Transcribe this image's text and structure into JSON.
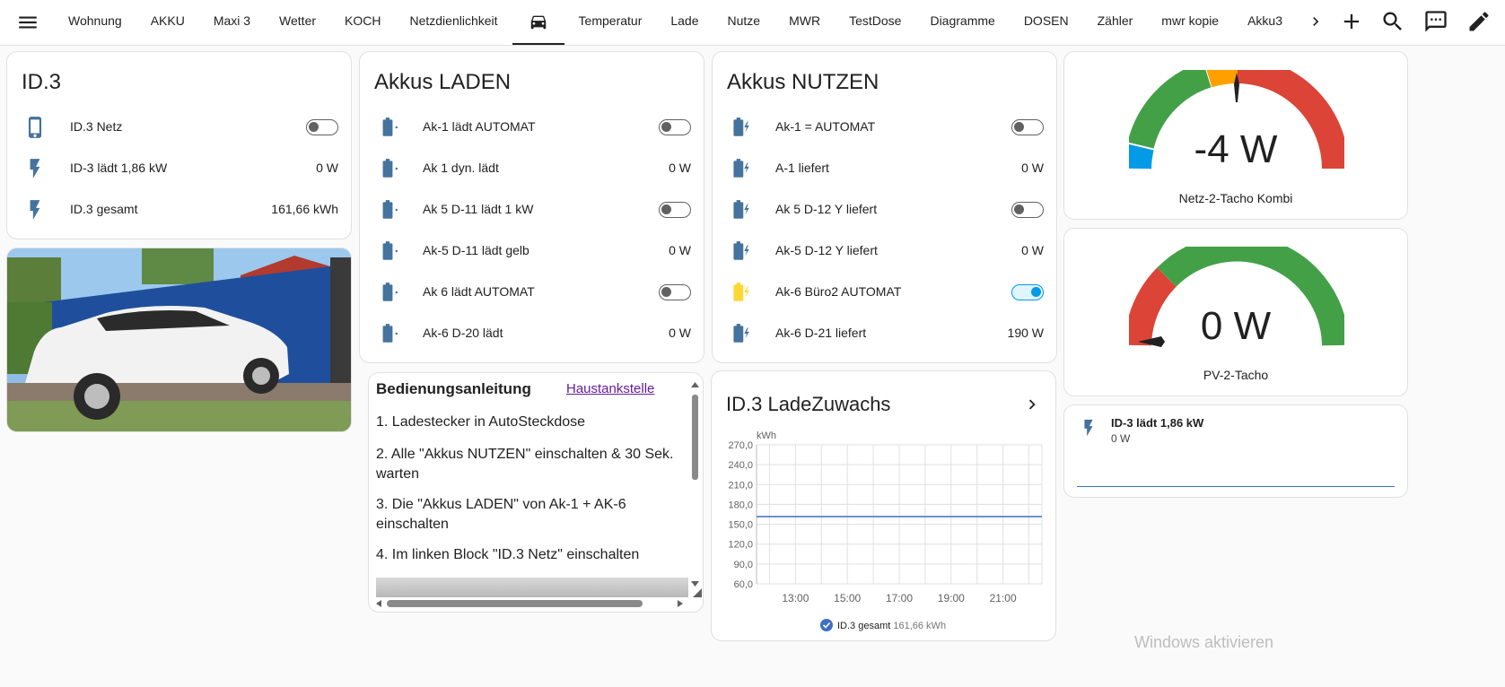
{
  "header": {
    "tabs": [
      "Wohnung",
      "AKKU",
      "Maxi 3",
      "Wetter",
      "KOCH",
      "Netzdienlichkeit",
      "",
      "Temperatur",
      "Lade",
      "Nutze",
      "MWR",
      "TestDose",
      "Diagramme",
      "DOSEN",
      "Zähler",
      "mwr kopie",
      "Akku3"
    ],
    "active_tab_icon": "car-icon"
  },
  "id3": {
    "title": "ID.3",
    "rows": [
      {
        "label": "ID.3 Netz",
        "icon": "phone-icon",
        "toggle": false
      },
      {
        "label": "ID-3 lädt 1,86 kW",
        "icon": "flash-icon",
        "value": "0 W"
      },
      {
        "label": "ID.3 gesamt",
        "icon": "flash-icon",
        "value": "161,66 kWh"
      }
    ]
  },
  "laden": {
    "title": "Akkus LADEN",
    "rows": [
      {
        "label": "Ak-1 lädt AUTOMAT",
        "toggle": false
      },
      {
        "label": "Ak 1 dyn. lädt",
        "value": "0 W"
      },
      {
        "label": "Ak 5 D-11 lädt 1 kW",
        "toggle": false
      },
      {
        "label": "Ak-5 D-11 lädt gelb",
        "value": "0 W"
      },
      {
        "label": "Ak 6 lädt AUTOMAT",
        "toggle": false
      },
      {
        "label": "Ak-6 D-20 lädt",
        "value": "0 W"
      }
    ]
  },
  "nutzen": {
    "title": "Akkus NUTZEN",
    "rows": [
      {
        "label": "Ak-1 = AUTOMAT",
        "toggle": false
      },
      {
        "label": "A-1 liefert",
        "value": "0 W"
      },
      {
        "label": "Ak 5 D-12 Y liefert",
        "toggle": false
      },
      {
        "label": "Ak-5 D-12 Y liefert",
        "value": "0 W"
      },
      {
        "label": "Ak-6 Büro2 AUTOMAT",
        "toggle": true
      },
      {
        "label": "Ak-6 D-21 liefert",
        "value": "190 W"
      }
    ]
  },
  "guide": {
    "title": "Bedienungsanleitung",
    "link": "Haustankstelle",
    "steps": [
      "1. Ladestecker in AutoSteckdose",
      "2. Alle \"Akkus NUTZEN\" einschalten & 30 Sek. warten",
      "3. Die \"Akkus LADEN\" von Ak-1 + AK-6 einschalten",
      "4. Im linken Block \"ID.3 Netz\" einschalten"
    ]
  },
  "chart_card": {
    "title": "ID.3 LadeZuwachs"
  },
  "chart_data": {
    "type": "line",
    "title": "ID.3 LadeZuwachs",
    "ylabel": "kWh",
    "y_ticks": [
      "270,0",
      "240,0",
      "210,0",
      "180,0",
      "150,0",
      "120,0",
      "90,0",
      "60,0"
    ],
    "x_ticks": [
      "13:00",
      "15:00",
      "17:00",
      "19:00",
      "21:00"
    ],
    "ylim": [
      60,
      270
    ],
    "series": [
      {
        "name": "ID.3 gesamt",
        "legend_value": "161,66 kWh",
        "color": "#3f6fc4",
        "x": [
          "11:30",
          "22:30"
        ],
        "values": [
          161.66,
          161.66
        ]
      }
    ]
  },
  "gauges": [
    {
      "value": "-4 W",
      "label": "Netz-2-Tacho Kombi"
    },
    {
      "value": "0 W",
      "label": "PV-2-Tacho"
    }
  ],
  "sensor_card": {
    "label": "ID-3 lädt 1,86 kW",
    "value": "0 W"
  },
  "watermark": "Windows aktivieren",
  "colors": {
    "accent": "#039be5",
    "icon_blue": "#44739e",
    "icon_active": "#fdd835",
    "gauge_green": "#43a047",
    "gauge_orange": "#ffa000",
    "gauge_red": "#db4437",
    "gauge_blue": "#039be5"
  }
}
